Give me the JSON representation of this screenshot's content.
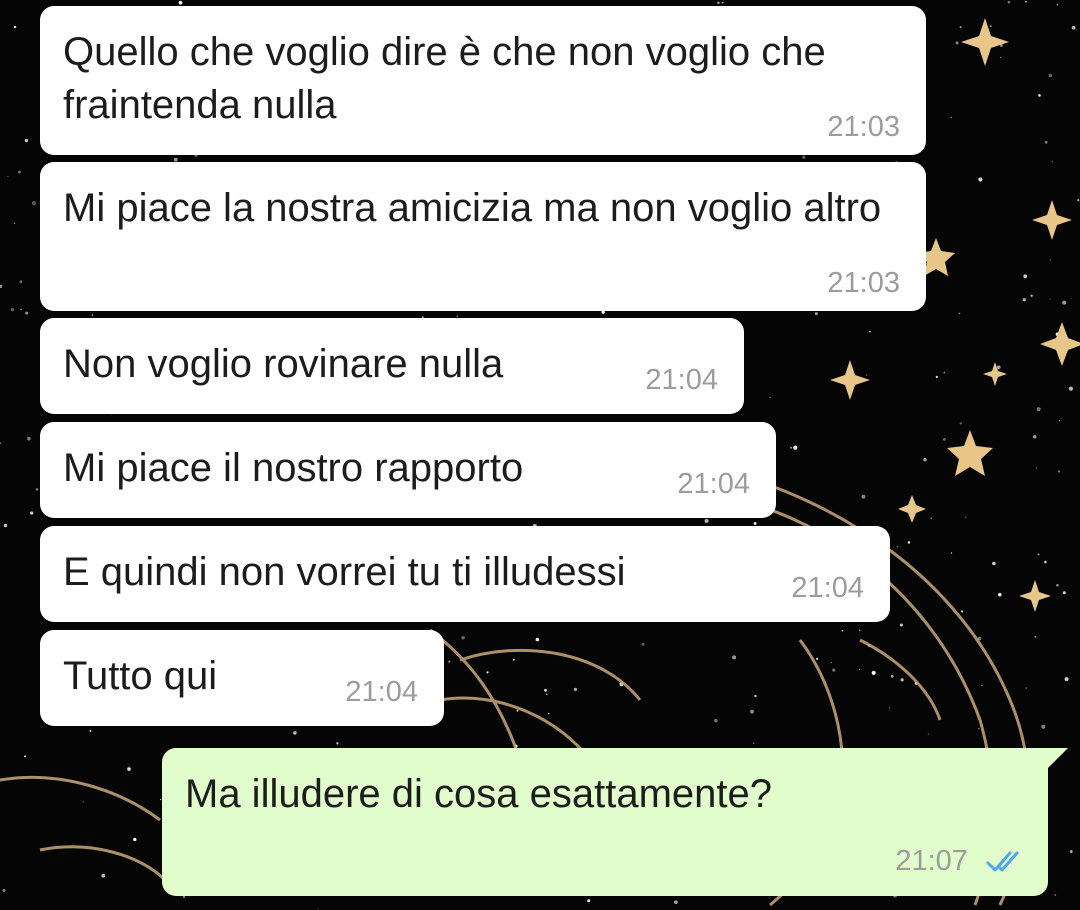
{
  "conversation": {
    "incoming": [
      {
        "text": "Quello che voglio dire è che non voglio che fraintenda nulla",
        "time": "21:03"
      },
      {
        "text": "Mi piace la nostra amicizia ma non voglio altro",
        "time": "21:03"
      },
      {
        "text": "Non voglio rovinare nulla",
        "time": "21:04"
      },
      {
        "text": "Mi piace il nostro rapporto",
        "time": "21:04"
      },
      {
        "text": "E quindi non vorrei tu ti illudessi",
        "time": "21:04"
      },
      {
        "text": "Tutto qui",
        "time": "21:04"
      }
    ],
    "outgoing": [
      {
        "text": "Ma illudere di cosa esattamente?",
        "time": "21:07",
        "status_icon": "double-check-read-icon"
      }
    ]
  },
  "colors": {
    "incoming_bubble": "#ffffff",
    "outgoing_bubble": "#e1fdcb",
    "timestamp": "#9c9c9c",
    "read_ticks": "#4fa6f2",
    "wallpaper": "#050506"
  }
}
